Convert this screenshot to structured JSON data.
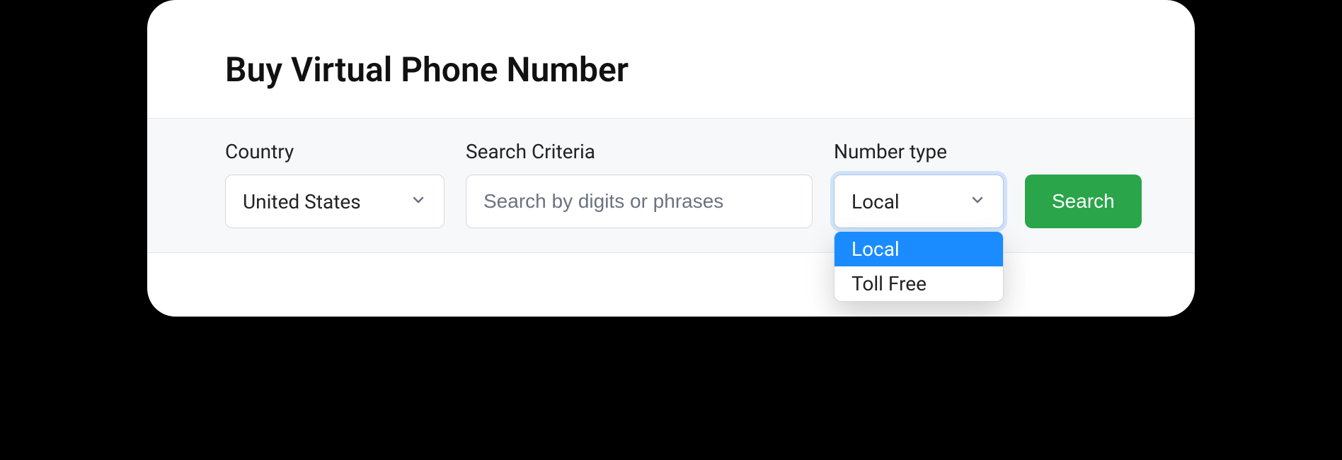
{
  "page": {
    "title": "Buy Virtual Phone Number"
  },
  "filters": {
    "country": {
      "label": "Country",
      "value": "United States"
    },
    "search": {
      "label": "Search Criteria",
      "placeholder": "Search by digits or phrases",
      "value": ""
    },
    "number_type": {
      "label": "Number type",
      "value": "Local",
      "options": [
        "Local",
        "Toll Free"
      ]
    },
    "search_button": "Search"
  },
  "colors": {
    "accent_green": "#2aa54a",
    "highlight_blue": "#1a8cff",
    "focus_ring": "#cfe2f8"
  }
}
